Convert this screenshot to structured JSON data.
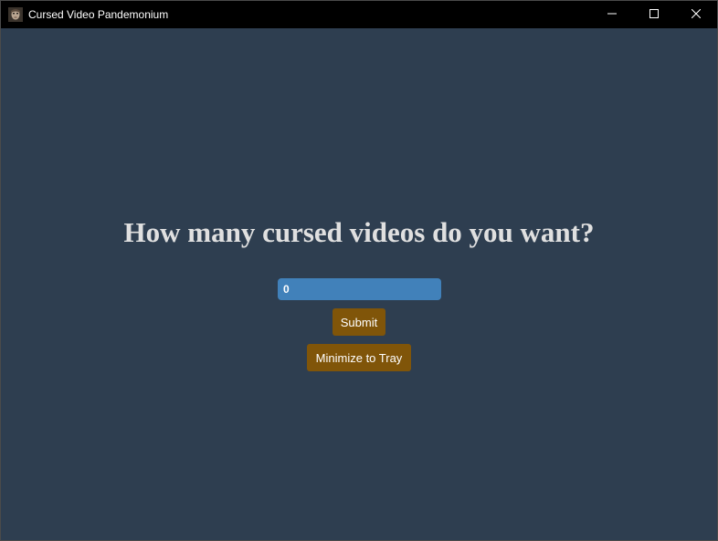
{
  "window": {
    "title": "Cursed Video Pandemonium",
    "icon": "app-face-icon",
    "controls": {
      "minimize_icon": "minimize-icon",
      "maximize_icon": "maximize-icon",
      "close_icon": "close-icon"
    }
  },
  "main": {
    "heading": "How many cursed videos do you want?",
    "count_input": {
      "value": "0",
      "placeholder": ""
    },
    "submit_label": "Submit",
    "tray_label": "Minimize to Tray"
  },
  "colors": {
    "background": "#2e3e50",
    "titlebar": "#000000",
    "input": "#4181ba",
    "button": "#805509",
    "heading": "#e0e0e0"
  }
}
